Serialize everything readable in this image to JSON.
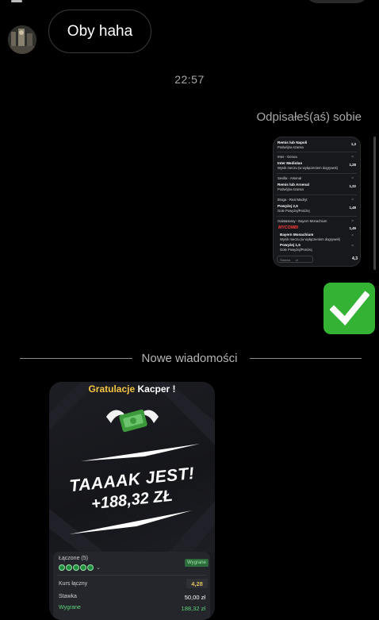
{
  "messages": {
    "received_text": "Oby haha",
    "timestamp": "22:57",
    "reply_label": "Odpisałeś(aś) sobie",
    "divider": "Nowe wiadomości"
  },
  "bet_slip": {
    "rows": [
      {
        "title": "Remis lub Napoli",
        "sub": "Podwójna szansa",
        "odd": "1,3"
      },
      {
        "match": "Inter - Genoa",
        "title": "Inter Mediolan",
        "sub": "Wynik meczu (w wyłączeniem dogrywek)",
        "odd": "1,28"
      },
      {
        "match": "Sevilla - Arsenal",
        "title": "Remis lub Arsenal",
        "sub": "Podwójna szansa",
        "odd": "1,22"
      },
      {
        "match": "Braga - Real Madryt",
        "title": "Powyżej 2,5",
        "sub": "Gole Powyżej/Poniżej",
        "odd": "1,48"
      },
      {
        "match": "Galatasaray - Bayern Monachium",
        "title": "MYCOMBI",
        "odd": "1,49"
      },
      {
        "title": "Bayern Monachium",
        "sub": "Wynik meczu (w wyłączeniem dogrywek)"
      },
      {
        "title": "Powyżej 1,5",
        "sub": "Gole Powyżej/Poniżej"
      }
    ],
    "stake_label": "Stawka",
    "stake_value": "zł",
    "total": "4,3"
  },
  "reaction_emoji": "white-heavy-check-mark",
  "win_card": {
    "title_prefix": "Gratulacje",
    "name": "Kacper !",
    "headline": "TAAAAK JEST!",
    "amount": "+188,32 ZŁ",
    "combined_label": "Łączone (5)",
    "status_badge": "Wygrane",
    "total_odds_label": "Kurs łączny",
    "total_odds": "4,28",
    "stake_label": "Stawka",
    "stake": "50,00 zł",
    "won_label": "Wygrane",
    "won": "188,32 zł"
  },
  "colors": {
    "background": "#000000",
    "bubble_border": "#3a3a3a",
    "check_green": "#34b233",
    "accent_yellow": "#f5c542",
    "win_green": "#2e6b3c",
    "mycombi_red": "#ff3c3c"
  }
}
